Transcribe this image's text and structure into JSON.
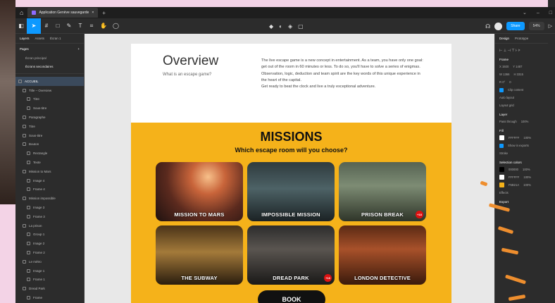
{
  "app": {
    "tab_title": "Application Genève sauvegarde",
    "colors": {
      "accent": "#0d99ff",
      "missions_bg": "#f5b21a",
      "canvas_bg": "#e8e8e8"
    }
  },
  "toolbar": {
    "share_label": "Share",
    "zoom_label": "54%"
  },
  "left_panel": {
    "tabs": [
      "Layers",
      "Assets",
      "Écran 1"
    ],
    "pages_label": "Pages",
    "pages": [
      "Écran principal",
      "Écrans secondaires"
    ],
    "layers": [
      "ACCUEIL",
      "Title – Overview",
      "Titre",
      "Sous-titre",
      "Paragraphe",
      "Titre",
      "Sous-titre",
      "Bouton",
      "Rectangle",
      "Texte",
      "Mission to Mars",
      "Image 4",
      "Frame 4",
      "Mission impossible",
      "Image 3",
      "Frame 3",
      "La prison",
      "Group 1",
      "Image 2",
      "Frame 2",
      "Le métro",
      "Image 1",
      "Frame 1",
      "Dread Park",
      "Frame"
    ]
  },
  "canvas": {
    "overview": {
      "title": "Overview",
      "subtitle": "What is an escape game?",
      "paragraph": "The live escape game is a new concept in entertainment. As a team, you have only one goal: get out of the room in 60 minutes or less. To do so, you'll have to solve a series of enigmas. Observation, logic, deduction and team spirit are the key words of this unique experience in the heart of the capital.",
      "paragraph2": "Get ready to beat the clock and live a truly exceptional adventure."
    },
    "missions": {
      "title": "MISSIONS",
      "subtitle": "Which escape room will you choose?",
      "cards": [
        {
          "label": "MISSION TO MARS",
          "badge": ""
        },
        {
          "label": "IMPOSSIBLE MISSION",
          "badge": ""
        },
        {
          "label": "PRISON BREAK",
          "badge": "+18"
        },
        {
          "label": "THE SUBWAY",
          "badge": ""
        },
        {
          "label": "DREAD PARK",
          "badge": "+18"
        },
        {
          "label": "LONDON DETECTIVE",
          "badge": ""
        }
      ],
      "book_label": "BOOK"
    }
  },
  "right_panel": {
    "tabs": [
      "Design",
      "Prototype"
    ],
    "frame_label": "Frame",
    "fields": [
      "X 1920",
      "Y 1487",
      "W 1366",
      "H 3315",
      "R 0°",
      "0"
    ],
    "clip_label": "Clip content",
    "auto_layout_label": "Auto layout",
    "layout_grid_label": "Layout grid",
    "layer_label": "Layer",
    "blend_label": "Pass through",
    "opacity": "100%",
    "fill_label": "Fill",
    "fill_value": "FFFFFF",
    "fill_opacity": "100%",
    "show_exports": "Show in exports",
    "stroke_label": "Stroke",
    "selection_colors_label": "Selection colors",
    "selection_colors": [
      {
        "hex": "000000",
        "opacity": "100%",
        "swatch": "#000000"
      },
      {
        "hex": "FFFFFF",
        "opacity": "100%",
        "swatch": "#ffffff"
      },
      {
        "hex": "F5B21A",
        "opacity": "100%",
        "swatch": "#f5b21a"
      }
    ],
    "effects_label": "Effects",
    "export_label": "Export"
  }
}
